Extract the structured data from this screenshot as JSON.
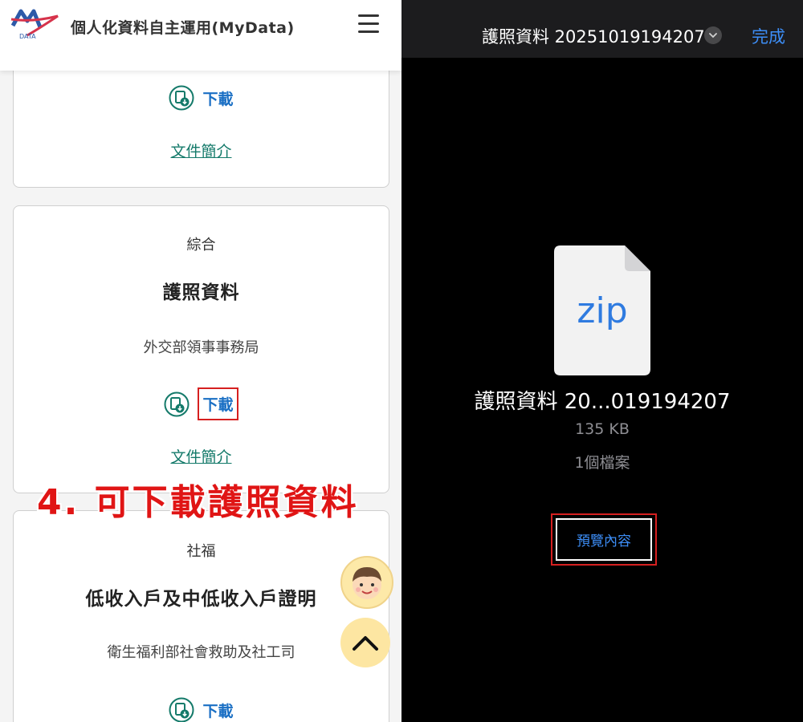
{
  "header": {
    "app_title": "個人化資料自主運用(MyData)",
    "logo_text": "DATA"
  },
  "cards": [
    {
      "download_label": "下載",
      "intro_label": "文件簡介"
    },
    {
      "category": "綜合",
      "title": "護照資料",
      "agency": "外交部領事事務局",
      "download_label": "下載",
      "intro_label": "文件簡介"
    },
    {
      "category": "社福",
      "title": "低收入戶及中低收入戶證明",
      "agency": "衛生福利部社會救助及社工司",
      "download_label": "下載"
    }
  ],
  "annotation": "4. 可下載護照資料",
  "viewer": {
    "title": "護照資料 20251019194207",
    "done_label": "完成",
    "file_type": "zip",
    "file_name": "護照資料 20...019194207",
    "file_size": "135 KB",
    "file_count": "1個檔案",
    "preview_label": "預覽內容"
  },
  "colors": {
    "link_blue": "#1a6fc4",
    "intro_teal": "#147a6a",
    "highlight_red": "#d62020",
    "ios_blue": "#3d8ef7"
  }
}
